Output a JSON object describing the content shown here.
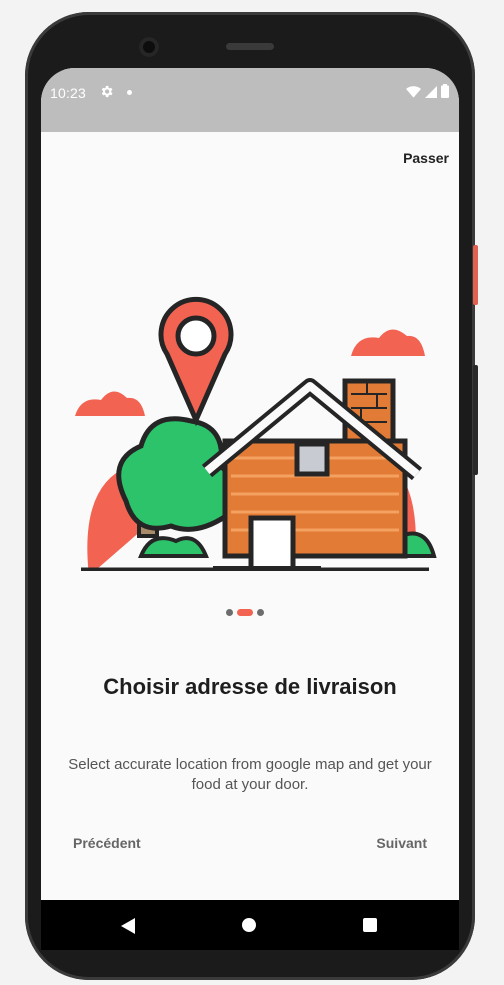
{
  "status_bar": {
    "time": "10:23",
    "icons": [
      "gear-icon",
      "notification-dot-icon",
      "wifi-icon",
      "signal-icon",
      "battery-icon"
    ]
  },
  "onboarding": {
    "skip_label": "Passer",
    "illustration": "house-with-location-pin",
    "page_indicator": {
      "count": 3,
      "active_index": 1
    },
    "title": "Choisir adresse de livraison",
    "description": "Select accurate location from google map and get your food at your door.",
    "prev_label": "Précédent",
    "next_label": "Suivant"
  },
  "nav_bar": {
    "icons": [
      "back-icon",
      "home-icon",
      "recents-icon"
    ]
  },
  "colors": {
    "accent": "#f26352",
    "house": "#e27b35",
    "tree": "#2cc36b",
    "status_bar": "#bdbdbd"
  }
}
